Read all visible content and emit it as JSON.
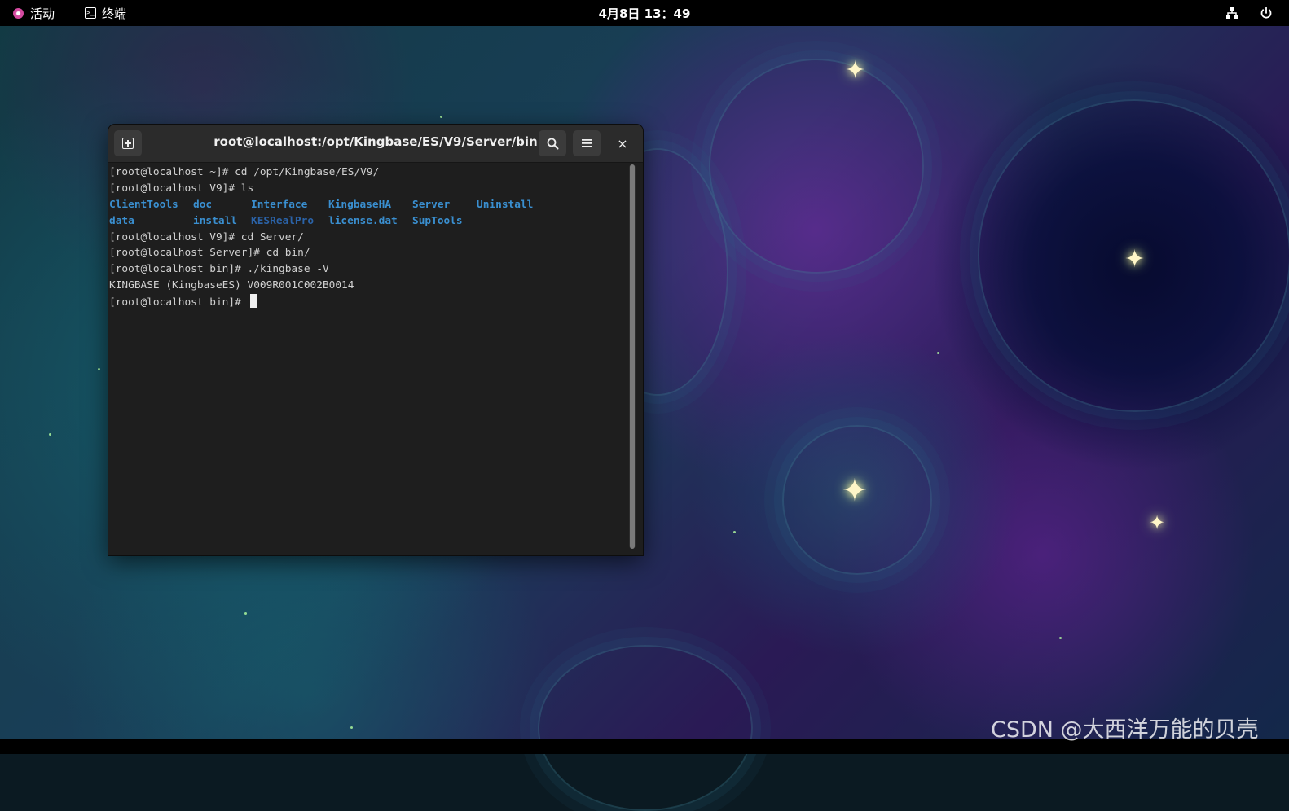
{
  "topbar": {
    "activities_label": "活动",
    "app_menu_label": "终端",
    "clock": "4月8日  13：49",
    "network_icon": "network-icon",
    "power_icon": "power-icon"
  },
  "terminal": {
    "title": "root@localhost:/opt/Kingbase/ES/V9/Server/bin",
    "new_tab_icon": "new-tab-icon",
    "search_icon": "search-icon",
    "menu_icon": "hamburger-menu-icon",
    "close_label": "×",
    "lines": [
      "[root@localhost ~]# cd /opt/Kingbase/ES/V9/",
      "[root@localhost V9]# ls",
      "",
      "",
      "[root@localhost V9]# cd Server/",
      "[root@localhost Server]# cd bin/",
      "[root@localhost bin]# ./kingbase -V",
      "KINGBASE (KingbaseES) V009R001C002B0014",
      "[root@localhost bin]# "
    ],
    "ls_row1": [
      "ClientTools",
      "doc",
      "Interface",
      "KingbaseHA",
      "Server",
      "Uninstall"
    ],
    "ls_row2": [
      "data",
      "install",
      "KESRealPro",
      "license.dat",
      "SupTools"
    ]
  },
  "watermark": "CSDN @大西洋万能的贝壳",
  "colors": {
    "topbar_bg": "#000000",
    "terminal_bg": "#1e1e1e",
    "titlebar_bg": "#2b2b2b",
    "dir_blue": "#3a8fd0"
  }
}
